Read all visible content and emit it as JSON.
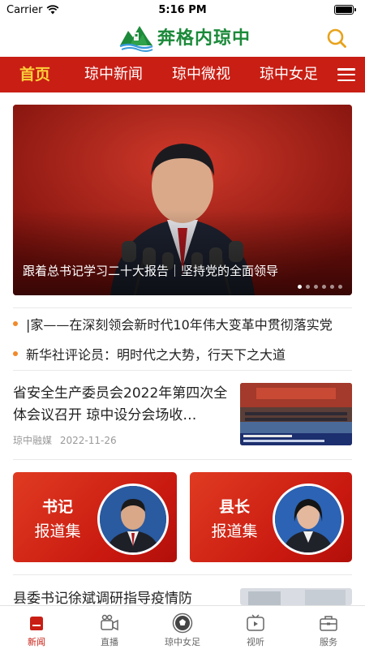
{
  "status_bar": {
    "carrier": "Carrier",
    "time": "5:16 PM"
  },
  "header": {
    "logo_text": "奔格内琼中"
  },
  "nav": {
    "tabs": [
      {
        "label": "首页",
        "active": true
      },
      {
        "label": "琼中新闻",
        "active": false
      },
      {
        "label": "琼中微视",
        "active": false
      },
      {
        "label": "琼中女足",
        "active": false
      }
    ]
  },
  "banner": {
    "caption": "跟着总书记学习二十大报告｜坚持党的全面领导",
    "slide_count": 6,
    "active_slide": 1
  },
  "ticker": [
    "|家——在深刻领会新时代10年伟大变革中贯彻落实党",
    "新华社评论员：明时代之大势，行天下之大道"
  ],
  "news": [
    {
      "title": "省安全生产委员会2022年第四次全体会议召开 琼中设分会场收…",
      "source": "琼中融媒",
      "date": "2022-11-26"
    },
    {
      "title": "县委书记徐斌调研指导疫情防"
    }
  ],
  "cards": [
    {
      "title": "书记",
      "subtitle": "报道集"
    },
    {
      "title": "县长",
      "subtitle": "报道集"
    }
  ],
  "tabbar": [
    {
      "label": "新闻",
      "icon": "news-icon",
      "active": true
    },
    {
      "label": "直播",
      "icon": "live-camera-icon",
      "active": false
    },
    {
      "label": "琼中女足",
      "icon": "soccer-ball-icon",
      "active": false
    },
    {
      "label": "视听",
      "icon": "tv-play-icon",
      "active": false
    },
    {
      "label": "服务",
      "icon": "briefcase-icon",
      "active": false
    }
  ],
  "colors": {
    "brand_red": "#c81e14",
    "active_tab_yellow": "#ffd13a",
    "logo_green": "#1c8a3a",
    "search_gold": "#e8a21a",
    "bullet_orange": "#f08a2c"
  }
}
